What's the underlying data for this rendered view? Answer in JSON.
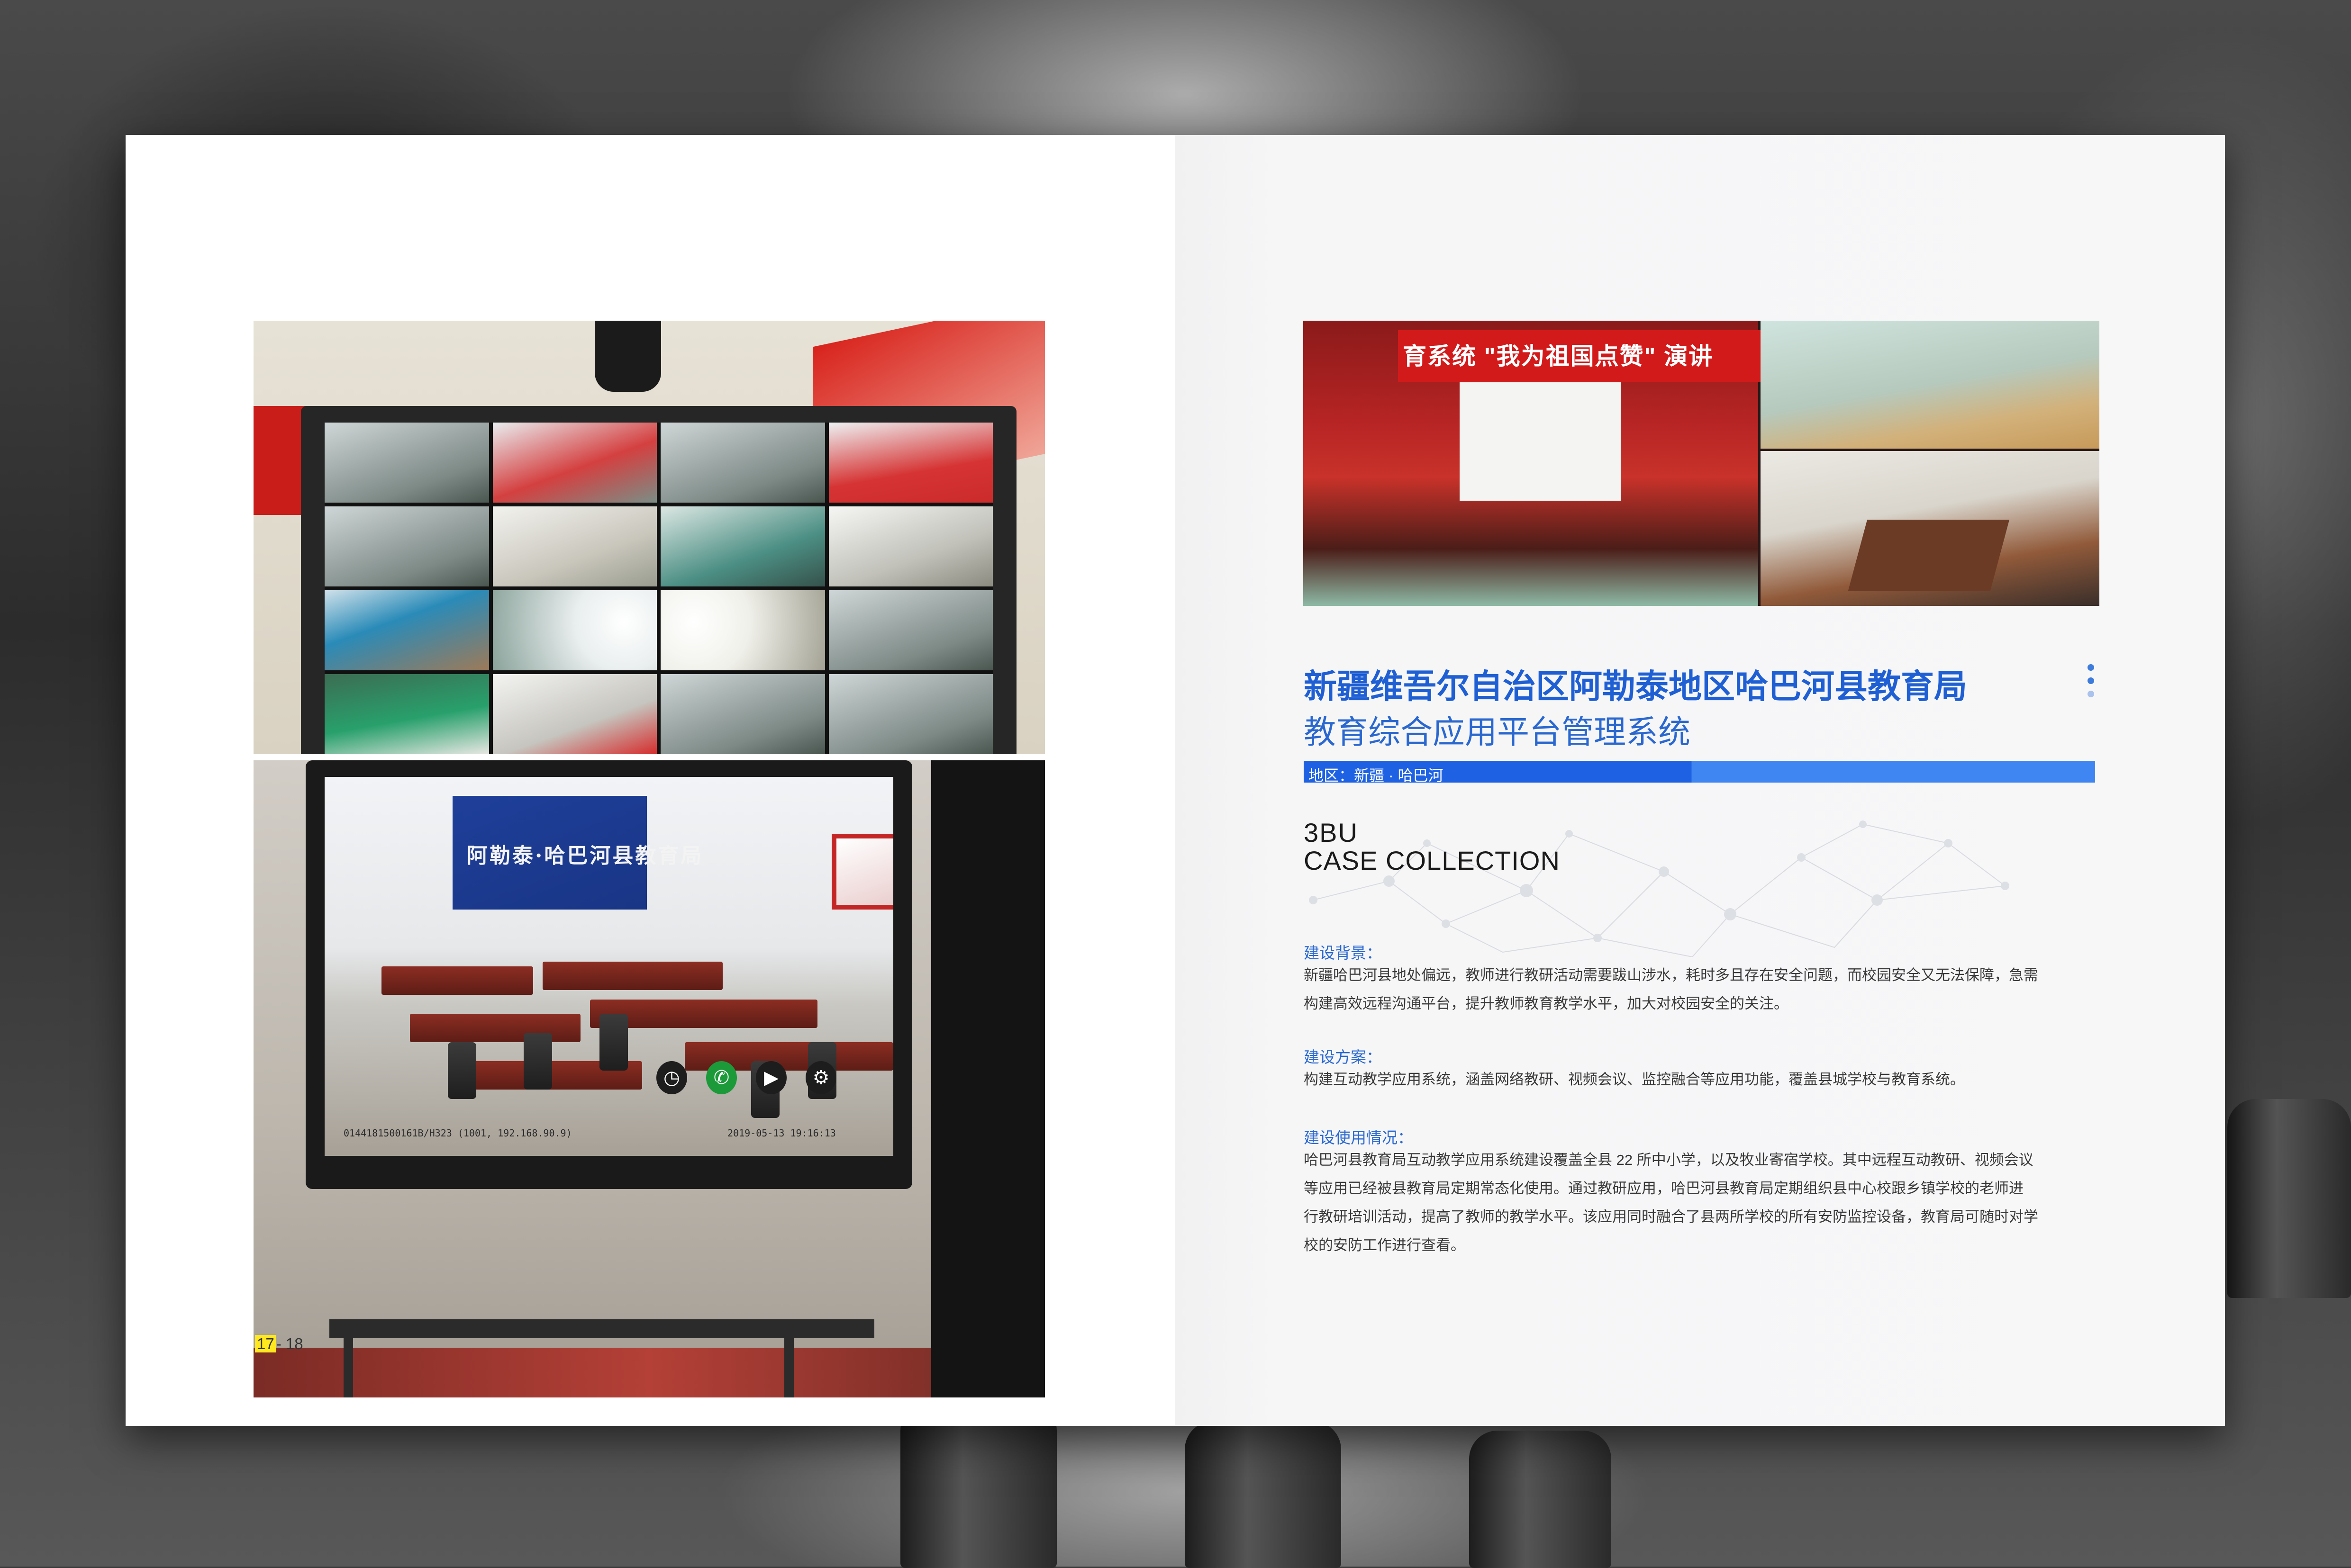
{
  "left_page": {
    "page_number_current": "17",
    "page_number_rest": "- 18",
    "photo_screen_banner": "阿勒泰·哈巴河县教育局",
    "photo_osd_left": "0144181500161B/H323 (1001, 192.168.90.9)",
    "photo_osd_time": "2019-05-13 19:16:13"
  },
  "right_page": {
    "photo_banner": "育系统 \"我为祖国点赞\" 演讲",
    "title": "新疆维吾尔自治区阿勒泰地区哈巴河县教育局",
    "subtitle": "教育综合应用平台管理系统",
    "region": "地区：新疆 · 哈巴河",
    "brand_line1": "3BU",
    "brand_line2": "CASE COLLECTION",
    "sections": [
      {
        "title": "建设背景：",
        "lines": [
          "新疆哈巴河县地处偏远，教师进行教研活动需要跋山涉水，耗时多且存在安全问题，而校园安全又无法保障，急需",
          "构建高效远程沟通平台，提升教师教育教学水平，加大对校园安全的关注。"
        ]
      },
      {
        "title": "建设方案：",
        "lines": [
          "构建互动教学应用系统，涵盖网络教研、视频会议、监控融合等应用功能，覆盖县城学校与教育系统。"
        ]
      },
      {
        "title": "建设使用情况：",
        "lines": [
          "哈巴河县教育局互动教学应用系统建设覆盖全县 22 所中小学，以及牧业寄宿学校。其中远程互动教研、视频会议",
          "等应用已经被县教育局定期常态化使用。通过教研应用，哈巴河县教育局定期组织县中心校跟乡镇学校的老师进",
          "行教研培训活动，提高了教师的教学水平。该应用同时融合了县两所学校的所有安防监控设备，教育局可随时对学",
          "校的安防工作进行查看。"
        ]
      }
    ]
  },
  "colors": {
    "accent_blue": "#1f5fd4",
    "region_bar": "#1e62e3",
    "page_highlight": "#ffe81e"
  }
}
